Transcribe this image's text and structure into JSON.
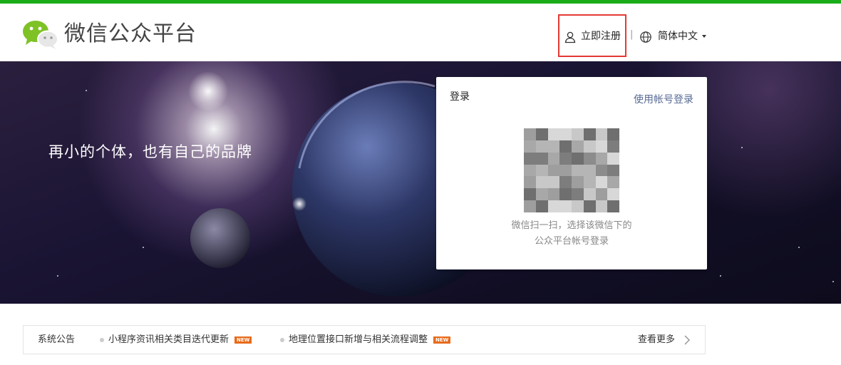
{
  "header": {
    "brand_name": "微信公众平台",
    "register_label": "立即注册",
    "separator": "|",
    "language_label": "简体中文"
  },
  "banner": {
    "slogan": "再小的个体，也有自己的品牌"
  },
  "login": {
    "title": "登录",
    "account_login_link": "使用帐号登录",
    "qr_tip_line1": "微信扫一扫，选择该微信下的",
    "qr_tip_line2": "公众平台帐号登录"
  },
  "notices": {
    "label": "系统公告",
    "items": [
      {
        "text": "小程序资讯相关类目迭代更新",
        "badge": "NEW"
      },
      {
        "text": "地理位置接口新增与相关流程调整",
        "badge": "NEW"
      }
    ],
    "more_label": "查看更多"
  },
  "colors": {
    "brand_green": "#1aad19",
    "highlight_red": "#e53935",
    "link_blue": "#576b95",
    "new_badge": "#e76b1c"
  },
  "icons": {
    "logo": "wechat-logo",
    "register": "user-icon",
    "language": "globe-icon",
    "language_caret": "caret-down-icon",
    "more": "chevron-right-icon"
  }
}
